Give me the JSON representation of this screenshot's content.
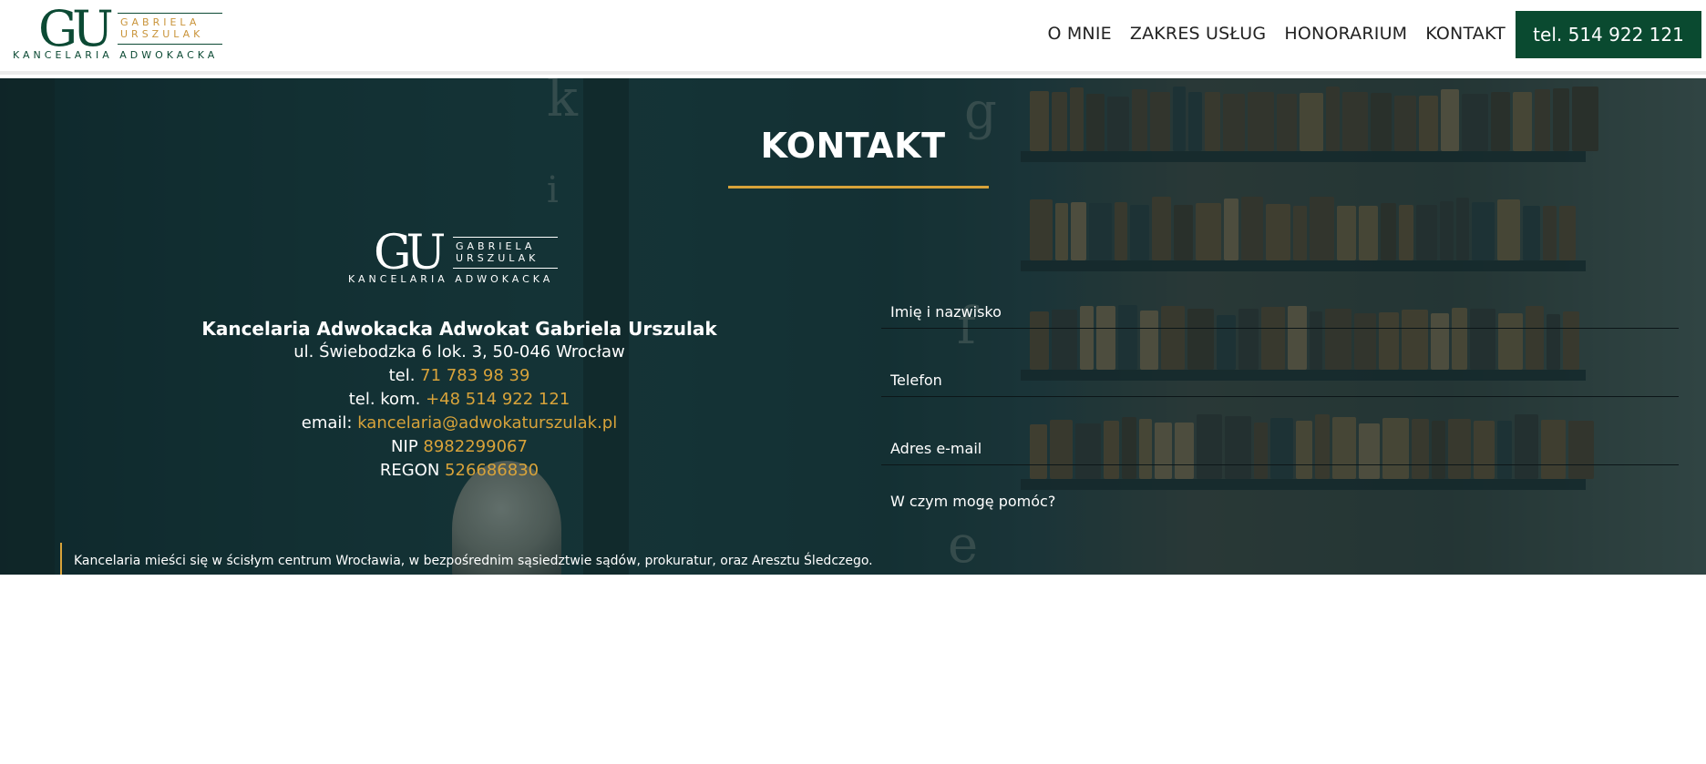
{
  "header": {
    "logo": {
      "initials": "GU",
      "name_line1": "GABRIELA",
      "name_line2": "URSZULAK",
      "subtitle": "KANCELARIA ADWOKACKA"
    },
    "nav": [
      "O MNIE",
      "ZAKRES USŁUG",
      "HONORARIUM",
      "KONTAKT"
    ],
    "phone_button": "tel. 514 922 121"
  },
  "contact": {
    "title": "KONTAKT",
    "logo": {
      "initials": "GU",
      "name_line1": "GABRIELA",
      "name_line2": "URSZULAK",
      "subtitle": "KANCELARIA ADWOKACKA"
    },
    "firm_name": "Kancelaria Adwokacka Adwokat Gabriela Urszulak",
    "address": "ul. Świebodzka 6 lok. 3, 50-046 Wrocław",
    "tel_label": "tel. ",
    "tel_value": "71 783 98 39",
    "mobile_label": "tel. kom. ",
    "mobile_value": "+48 514 922 121",
    "email_label": "email: ",
    "email_value": "kancelaria@adwokaturszulak.pl",
    "nip_label": "NIP ",
    "nip_value": "8982299067",
    "regon_label": "REGON ",
    "regon_value": "526686830",
    "note": "Kancelaria mieści się w ścisłym centrum Wrocławia, w bezpośrednim sąsiedztwie sądów, prokuratur, oraz Aresztu Śledczego."
  },
  "form": {
    "name_placeholder": "Imię i nazwisko",
    "phone_placeholder": "Telefon",
    "email_placeholder": "Adres e-mail",
    "message_placeholder": "W czym mogę pomóc?"
  },
  "colors": {
    "brand_green": "#0a4a30",
    "gold": "#d8a33a"
  }
}
